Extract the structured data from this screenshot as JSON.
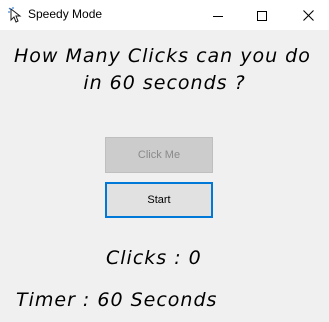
{
  "window": {
    "title": "Speedy Mode",
    "app_icon": "cursor-icon",
    "controls": [
      "minimize-icon",
      "maximize-icon",
      "close-icon"
    ]
  },
  "heading": {
    "line1": "How Many Clicks can you do",
    "line2": "in 60 seconds ?"
  },
  "buttons": {
    "click_me": {
      "label": "Click Me",
      "enabled": false
    },
    "start": {
      "label": "Start",
      "focused": true
    }
  },
  "stats": {
    "clicks": "Clicks : 0",
    "timer": "Timer : 60 Seconds"
  },
  "colors": {
    "window_bg": "#f0f0f0",
    "titlebar_bg": "#ffffff",
    "focus_border": "#0078d7",
    "disabled_bg": "#cccccc",
    "disabled_text": "#8a8a8a"
  }
}
